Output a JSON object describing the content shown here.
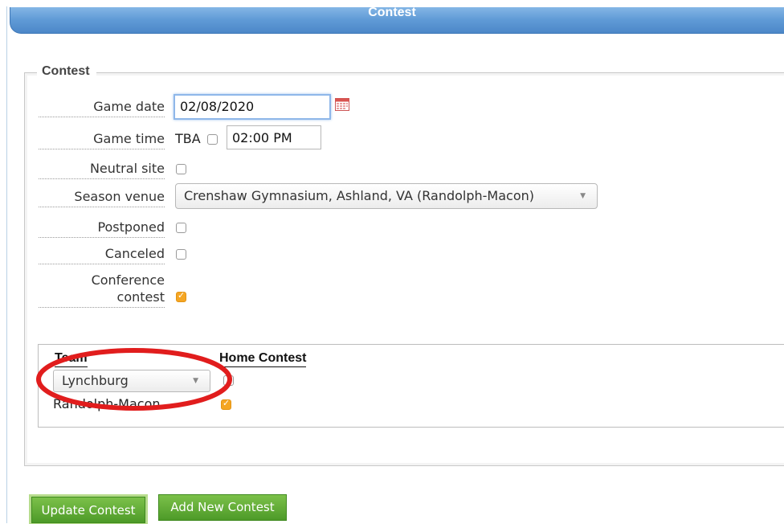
{
  "header": {
    "title": "Contest"
  },
  "section": {
    "legend": "Contest"
  },
  "form": {
    "game_date": {
      "label": "Game date",
      "value": "02/08/2020"
    },
    "game_time": {
      "label": "Game time",
      "tba_label": "TBA",
      "tba_checked": false,
      "value": "02:00 PM"
    },
    "neutral_site": {
      "label": "Neutral site",
      "checked": false
    },
    "season_venue": {
      "label": "Season venue",
      "selected": "Crenshaw Gymnasium, Ashland, VA (Randolph-Macon)"
    },
    "postponed": {
      "label": "Postponed",
      "checked": false
    },
    "canceled": {
      "label": "Canceled",
      "checked": false
    },
    "conference_contest": {
      "label_line1": "Conference",
      "label_line2": "contest",
      "checked": true
    }
  },
  "teams_table": {
    "headers": {
      "team": "Team",
      "home_contest": "Home Contest"
    },
    "rows": [
      {
        "team": "Lynchburg",
        "home_checked": false,
        "is_select": true
      },
      {
        "team": "Randolph-Macon",
        "home_checked": true,
        "is_select": false
      }
    ]
  },
  "buttons": {
    "update": "Update Contest",
    "add_new": "Add New Contest"
  },
  "colors": {
    "header_blue": "#5f9ad6",
    "checkbox_orange": "#f5a623",
    "button_green": "#5aa52f",
    "highlight_red": "#e11d1d"
  }
}
